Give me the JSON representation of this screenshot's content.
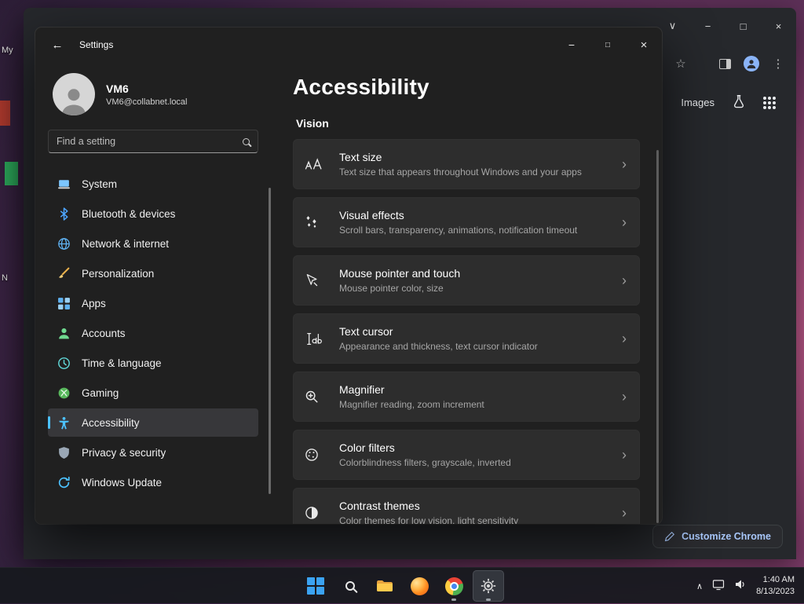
{
  "colors": {
    "accent": "#4cc2ff",
    "chrome_link": "#a8c7fa"
  },
  "glyphs": {
    "back": "←",
    "minimize": "−",
    "maximize": "□",
    "close": "×",
    "chevron_right": "›",
    "chevron_down": "∨",
    "chevron_up": "∧",
    "dots": "⋮",
    "star": "☆"
  },
  "desktop": {
    "label_top": "My",
    "label_mid": "N"
  },
  "browser": {
    "images_label": "Images",
    "customize_label": "Customize Chrome"
  },
  "settings": {
    "title": "Settings",
    "user": {
      "name": "VM6",
      "email": "VM6@collabnet.local"
    },
    "search_placeholder": "Find a setting",
    "nav": [
      {
        "label": "System"
      },
      {
        "label": "Bluetooth & devices"
      },
      {
        "label": "Network & internet"
      },
      {
        "label": "Personalization"
      },
      {
        "label": "Apps"
      },
      {
        "label": "Accounts"
      },
      {
        "label": "Time & language"
      },
      {
        "label": "Gaming"
      },
      {
        "label": "Accessibility"
      },
      {
        "label": "Privacy & security"
      },
      {
        "label": "Windows Update"
      }
    ],
    "page": {
      "title": "Accessibility",
      "section": "Vision",
      "items": [
        {
          "title": "Text size",
          "subtitle": "Text size that appears throughout Windows and your apps"
        },
        {
          "title": "Visual effects",
          "subtitle": "Scroll bars, transparency, animations, notification timeout"
        },
        {
          "title": "Mouse pointer and touch",
          "subtitle": "Mouse pointer color, size"
        },
        {
          "title": "Text cursor",
          "subtitle": "Appearance and thickness, text cursor indicator"
        },
        {
          "title": "Magnifier",
          "subtitle": "Magnifier reading, zoom increment"
        },
        {
          "title": "Color filters",
          "subtitle": "Colorblindness filters, grayscale, inverted"
        },
        {
          "title": "Contrast themes",
          "subtitle": "Color themes for low vision, light sensitivity"
        }
      ]
    }
  },
  "taskbar": {
    "time": "1:40 AM",
    "date": "8/13/2023"
  }
}
